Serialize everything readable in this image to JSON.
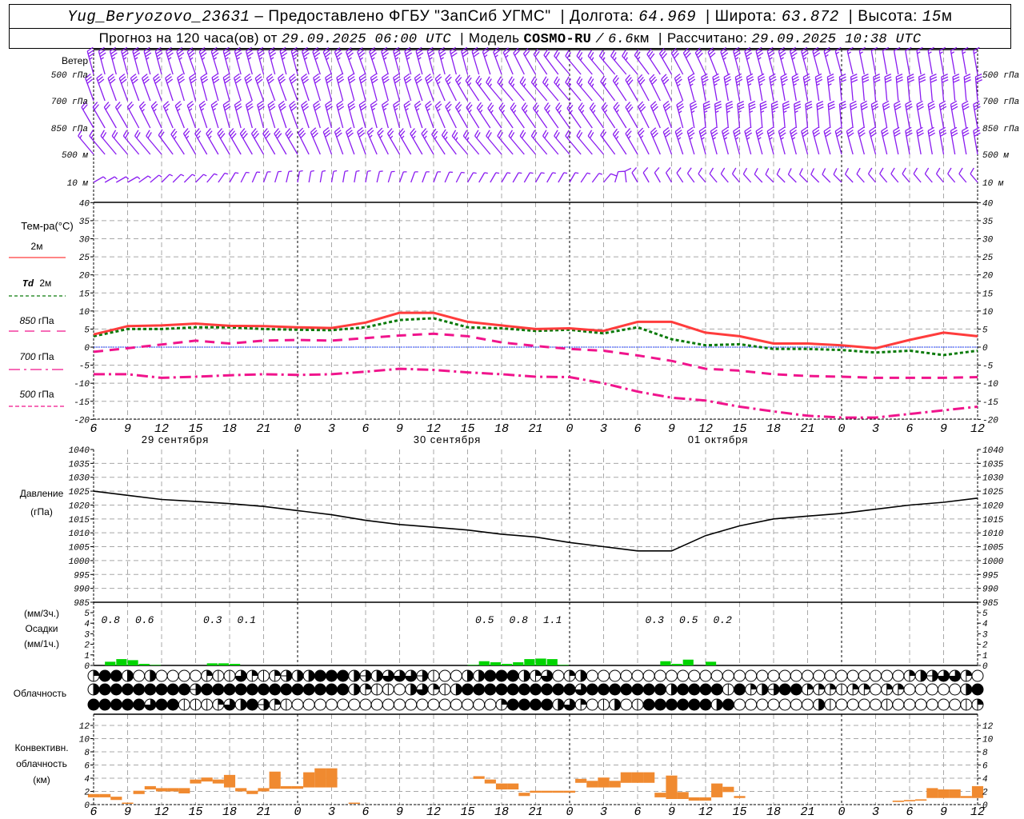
{
  "header": {
    "station": "Yug_Beryozovo_23631",
    "provider": "– Предоставлено ФГБУ \"ЗапСиб УГМС\"",
    "lon_label": "Долгота:",
    "lon": "64.969",
    "lat_label": "Широта:",
    "lat": "63.872",
    "alt_label": "Высота:",
    "alt": "15",
    "alt_unit": "м",
    "forecast_label": "Прогноз на 120 часа(ов) от",
    "forecast_start": "29.09.2025 06:00 UTC",
    "model_label": "Модель",
    "model": "COSMO-RU",
    "model_sep": "/",
    "resolution": "6.6",
    "res_unit": "км",
    "calc_label": "Рассчитано:",
    "calc_time": "29.09.2025 10:38 UTC"
  },
  "colors": {
    "t2m": "#ff3c3c",
    "td2m": "#0a7a0a",
    "t850": "#f0148c",
    "t700": "#f0148c",
    "t500": "#f0148c",
    "zero_line": "#2040ff",
    "wind": "#8a1cf0",
    "precip": "#00d400",
    "convective": "#f08a30",
    "grid": "#a8a8a8"
  },
  "axis": {
    "hours_total": 78,
    "x_ticks": [
      "6",
      "9",
      "12",
      "15",
      "18",
      "21",
      "0",
      "3",
      "6",
      "9",
      "12",
      "15",
      "18",
      "21",
      "0",
      "3",
      "6",
      "9",
      "12",
      "15",
      "18",
      "21",
      "0",
      "3",
      "6",
      "9",
      "12"
    ],
    "day_boundary_hours": [
      18,
      42,
      66
    ],
    "dates": [
      {
        "label": "29 сентября",
        "hour": 7.2
      },
      {
        "label": "30 сентября",
        "hour": 31.2
      },
      {
        "label": "01 октября",
        "hour": 55.1
      }
    ]
  },
  "wind": {
    "title": "Ветер",
    "levels": [
      {
        "label": "500 гПа",
        "dir": [
          345,
          345,
          345,
          340,
          345,
          345,
          345,
          340,
          340,
          345,
          345,
          345,
          340,
          330,
          320,
          320,
          320,
          330,
          335,
          345,
          345,
          345,
          345,
          350,
          350,
          350,
          350
        ],
        "speed": [
          18,
          18,
          18,
          18,
          18,
          18,
          18,
          18,
          18,
          18,
          18,
          15,
          12,
          10,
          10,
          12,
          12,
          15,
          15,
          18,
          18,
          18,
          8,
          6,
          6,
          8,
          8
        ]
      },
      {
        "label": "700 гПа",
        "dir": [
          340,
          340,
          340,
          345,
          345,
          340,
          340,
          345,
          345,
          345,
          340,
          330,
          320,
          320,
          320,
          320,
          330,
          335,
          350,
          350,
          350,
          350,
          355,
          355,
          355,
          355,
          355
        ],
        "speed": [
          15,
          15,
          15,
          15,
          15,
          16,
          16,
          16,
          16,
          16,
          14,
          12,
          12,
          12,
          12,
          12,
          14,
          16,
          18,
          18,
          18,
          18,
          16,
          15,
          14,
          14,
          14
        ]
      },
      {
        "label": "850 гПа",
        "dir": [
          330,
          330,
          335,
          340,
          345,
          345,
          340,
          345,
          345,
          345,
          340,
          330,
          325,
          325,
          325,
          325,
          330,
          340,
          355,
          355,
          355,
          355,
          355,
          350,
          350,
          350,
          350
        ],
        "speed": [
          10,
          10,
          12,
          12,
          14,
          14,
          14,
          14,
          14,
          12,
          12,
          12,
          12,
          12,
          12,
          12,
          14,
          16,
          18,
          18,
          18,
          16,
          15,
          14,
          14,
          14,
          14
        ]
      },
      {
        "label": "500 м",
        "dir": [
          320,
          320,
          320,
          330,
          330,
          330,
          330,
          340,
          340,
          330,
          330,
          320,
          320,
          320,
          320,
          320,
          330,
          340,
          345,
          345,
          345,
          345,
          345,
          345,
          350,
          350,
          350
        ],
        "speed": [
          8,
          10,
          10,
          12,
          14,
          14,
          14,
          14,
          14,
          12,
          12,
          12,
          10,
          10,
          10,
          10,
          12,
          16,
          18,
          18,
          18,
          16,
          16,
          16,
          14,
          14,
          14
        ]
      },
      {
        "label": "10 м",
        "dir": [
          60,
          60,
          45,
          45,
          30,
          20,
          10,
          10,
          10,
          20,
          20,
          30,
          30,
          30,
          30,
          40,
          330,
          330,
          320,
          320,
          315,
          315,
          315,
          320,
          320,
          320,
          320
        ],
        "speed": [
          3,
          3,
          3,
          3,
          3,
          3,
          3,
          3,
          3,
          3,
          3,
          3,
          3,
          3,
          3,
          4,
          6,
          6,
          6,
          5,
          5,
          4,
          4,
          4,
          5,
          5,
          5
        ]
      }
    ]
  },
  "temperature": {
    "title": "Тем-ра(°C)",
    "range": [
      -20,
      40
    ],
    "step": 5,
    "legend": [
      {
        "key": "t2m",
        "level": "2м"
      },
      {
        "key": "td2m",
        "prefix": "Td",
        "level": "2м"
      },
      {
        "key": "t850",
        "value": "850",
        "unit": "гПа"
      },
      {
        "key": "t700",
        "value": "700",
        "unit": "гПа"
      },
      {
        "key": "t500",
        "value": "500",
        "unit": "гПа"
      }
    ],
    "series_step_hours": 3,
    "t2m": [
      3.5,
      5.8,
      6.0,
      6.5,
      5.9,
      5.8,
      5.5,
      5.3,
      6.8,
      9.5,
      9.5,
      7.0,
      6.0,
      5.0,
      5.2,
      4.5,
      7.0,
      7.0,
      4.0,
      3.0,
      1.0,
      1.0,
      0.5,
      -0.3,
      2.0,
      4.0,
      3.0
    ],
    "td2m": [
      3.0,
      5.0,
      5.0,
      5.5,
      5.5,
      5.0,
      4.8,
      4.7,
      5.5,
      7.5,
      8.0,
      5.5,
      5.2,
      4.5,
      4.8,
      3.8,
      5.5,
      2.2,
      0.5,
      0.8,
      -0.5,
      -0.5,
      -0.8,
      -1.5,
      -1.0,
      -2.2,
      -1.0
    ],
    "t850": [
      -1.3,
      -0.3,
      0.7,
      1.8,
      1.0,
      1.8,
      2.0,
      1.8,
      2.5,
      3.2,
      3.7,
      3.0,
      1.3,
      0.3,
      -0.5,
      -1.0,
      -2.3,
      -3.8,
      -6.0,
      -6.5,
      -7.5,
      -8.0,
      -8.2,
      -8.5,
      -8.5,
      -8.5,
      -8.3
    ],
    "t700": [
      -7.5,
      -7.5,
      -8.5,
      -8.2,
      -7.8,
      -7.5,
      -7.7,
      -7.5,
      -6.8,
      -6.0,
      -6.3,
      -7.0,
      -7.5,
      -8.2,
      -8.3,
      -10.0,
      -12.3,
      -14.0,
      -14.8,
      -16.5,
      -17.8,
      -19.0,
      -19.5,
      -19.5,
      -18.5,
      -17.5,
      -16.5
    ]
  },
  "pressure": {
    "title": "Давление",
    "unit": "(гПа)",
    "range": [
      985,
      1040
    ],
    "step": 5,
    "values": [
      1025,
      1023.5,
      1022,
      1021.3,
      1020.5,
      1019.5,
      1018,
      1016.5,
      1014.5,
      1013,
      1012,
      1011,
      1009.5,
      1008.5,
      1006.5,
      1005,
      1003.5,
      1003.5,
      1009,
      1012.5,
      1015,
      1016,
      1017,
      1018.5,
      1020,
      1021,
      1022.5
    ]
  },
  "precipitation": {
    "unit_3h": "(мм/3ч.)",
    "title": "Осадки",
    "unit_1h": "(мм/1ч.)",
    "range": [
      0,
      5
    ],
    "step": 1,
    "hourly": [
      {
        "hour": 1,
        "mm": 0.35
      },
      {
        "hour": 2,
        "mm": 0.6
      },
      {
        "hour": 3,
        "mm": 0.5
      },
      {
        "hour": 4,
        "mm": 0.15
      },
      {
        "hour": 5,
        "mm": 0.05
      },
      {
        "hour": 10,
        "mm": 0.2
      },
      {
        "hour": 11,
        "mm": 0.2
      },
      {
        "hour": 12,
        "mm": 0.15
      },
      {
        "hour": 33,
        "mm": 0.05
      },
      {
        "hour": 34,
        "mm": 0.4
      },
      {
        "hour": 35,
        "mm": 0.3
      },
      {
        "hour": 36,
        "mm": 0.15
      },
      {
        "hour": 37,
        "mm": 0.3
      },
      {
        "hour": 38,
        "mm": 0.6
      },
      {
        "hour": 39,
        "mm": 0.65
      },
      {
        "hour": 40,
        "mm": 0.6
      },
      {
        "hour": 41,
        "mm": 0.05
      },
      {
        "hour": 50,
        "mm": 0.4
      },
      {
        "hour": 51,
        "mm": 0.15
      },
      {
        "hour": 52,
        "mm": 0.55
      },
      {
        "hour": 54,
        "mm": 0.35
      }
    ],
    "sums_3h": [
      {
        "hour": 1.5,
        "label": "0.8"
      },
      {
        "hour": 4.5,
        "label": "0.6"
      },
      {
        "hour": 10.5,
        "label": "0.3"
      },
      {
        "hour": 13.5,
        "label": "0.1"
      },
      {
        "hour": 34.5,
        "label": "0.5"
      },
      {
        "hour": 37.5,
        "label": "0.8"
      },
      {
        "hour": 40.5,
        "label": "1.1"
      },
      {
        "hour": 49.5,
        "label": "0.3"
      },
      {
        "hour": 52.5,
        "label": "0.5"
      },
      {
        "hour": 55.5,
        "label": "0.2"
      }
    ]
  },
  "clouds": {
    "title": "Облачность",
    "legend_codes": {
      "0": "clear",
      "1": "quarter",
      "2": "line",
      "3": "half",
      "4": "three-quarter",
      "5": "overcast",
      "6": "split"
    },
    "rows": [
      {
        "level": "high",
        "codes": "1553030000122412163355536344462003355531401300000000000000000000000000001364410"
      },
      {
        "level": "middle",
        "codes": "3555555556555555555555531220341235555555555455555553555525136551112110110000035"
      },
      {
        "level": "low",
        "codes": "5555545522214356120000000000000000001555534102302555555350000000320000200000021"
      }
    ]
  },
  "convective": {
    "title1": "Конвективн.",
    "title2": "облачность",
    "unit": "(км)",
    "range": [
      0,
      12
    ],
    "step": 2,
    "bars": [
      {
        "hour": 0,
        "base": 1.1,
        "top": 1.6
      },
      {
        "hour": 1,
        "base": 1.1,
        "top": 1.6
      },
      {
        "hour": 2,
        "base": 0.7,
        "top": 1.2
      },
      {
        "hour": 3,
        "base": 0.2,
        "top": 0.3
      },
      {
        "hour": 4,
        "base": 1.6,
        "top": 2.1
      },
      {
        "hour": 5,
        "base": 2.3,
        "top": 2.8
      },
      {
        "hour": 6,
        "base": 2.0,
        "top": 2.5
      },
      {
        "hour": 7,
        "base": 2.0,
        "top": 2.5
      },
      {
        "hour": 8,
        "base": 1.7,
        "top": 2.5
      },
      {
        "hour": 9,
        "base": 3.2,
        "top": 3.8
      },
      {
        "hour": 10,
        "base": 3.5,
        "top": 4.1
      },
      {
        "hour": 11,
        "base": 3.2,
        "top": 3.8
      },
      {
        "hour": 12,
        "base": 2.6,
        "top": 4.5
      },
      {
        "hour": 13,
        "base": 2.0,
        "top": 2.5
      },
      {
        "hour": 14,
        "base": 1.6,
        "top": 2.1
      },
      {
        "hour": 15,
        "base": 2.0,
        "top": 2.5
      },
      {
        "hour": 16,
        "base": 2.4,
        "top": 5.0
      },
      {
        "hour": 17,
        "base": 2.4,
        "top": 2.8
      },
      {
        "hour": 18,
        "base": 2.4,
        "top": 2.8
      },
      {
        "hour": 19,
        "base": 2.6,
        "top": 4.9
      },
      {
        "hour": 20,
        "base": 2.6,
        "top": 5.5
      },
      {
        "hour": 21,
        "base": 2.6,
        "top": 5.5
      },
      {
        "hour": 23,
        "base": 0.2,
        "top": 0.3
      },
      {
        "hour": 34,
        "base": 3.9,
        "top": 4.3
      },
      {
        "hour": 35,
        "base": 3.2,
        "top": 3.8
      },
      {
        "hour": 36,
        "base": 2.3,
        "top": 3.2
      },
      {
        "hour": 37,
        "base": 2.3,
        "top": 3.2
      },
      {
        "hour": 38,
        "base": 1.3,
        "top": 1.8
      },
      {
        "hour": 39,
        "base": 1.8,
        "top": 2.1
      },
      {
        "hour": 40,
        "base": 1.8,
        "top": 2.1
      },
      {
        "hour": 41,
        "base": 1.8,
        "top": 2.1
      },
      {
        "hour": 42,
        "base": 1.8,
        "top": 2.1
      },
      {
        "hour": 43,
        "base": 3.3,
        "top": 3.9
      },
      {
        "hour": 44,
        "base": 2.6,
        "top": 3.6
      },
      {
        "hour": 45,
        "base": 2.6,
        "top": 4.1
      },
      {
        "hour": 46,
        "base": 2.6,
        "top": 3.6
      },
      {
        "hour": 47,
        "base": 3.3,
        "top": 4.9
      },
      {
        "hour": 48,
        "base": 3.3,
        "top": 4.9
      },
      {
        "hour": 49,
        "base": 3.3,
        "top": 4.9
      },
      {
        "hour": 50,
        "base": 1.1,
        "top": 1.8
      },
      {
        "hour": 51,
        "base": 0.85,
        "top": 4.4
      },
      {
        "hour": 52,
        "base": 0.85,
        "top": 1.9
      },
      {
        "hour": 53,
        "base": 0.6,
        "top": 1.1
      },
      {
        "hour": 54,
        "base": 0.6,
        "top": 1.1
      },
      {
        "hour": 55,
        "base": 1.1,
        "top": 3.2
      },
      {
        "hour": 56,
        "base": 1.9,
        "top": 2.7
      },
      {
        "hour": 57,
        "base": 1.0,
        "top": 1.3
      },
      {
        "hour": 71,
        "base": 0.4,
        "top": 0.6
      },
      {
        "hour": 72,
        "base": 0.5,
        "top": 0.7
      },
      {
        "hour": 73,
        "base": 0.6,
        "top": 0.8
      },
      {
        "hour": 74,
        "base": 1.0,
        "top": 2.5
      },
      {
        "hour": 75,
        "base": 1.0,
        "top": 2.3
      },
      {
        "hour": 76,
        "base": 1.0,
        "top": 2.3
      },
      {
        "hour": 77,
        "base": 1.0,
        "top": 1.3
      },
      {
        "hour": 78,
        "base": 1.0,
        "top": 2.8
      }
    ]
  }
}
